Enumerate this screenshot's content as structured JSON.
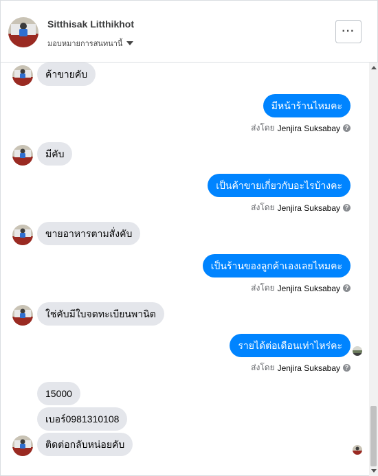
{
  "header": {
    "contact_name": "Sitthisak Litthikhot",
    "assign_label": "มอบหมายการสนทนานี้",
    "more_label": "···"
  },
  "messages": [
    {
      "side": "in",
      "text": "ค้าขายคับ"
    },
    {
      "side": "out",
      "text": "มีหน้าร้านไหมคะ",
      "sent_by_prefix": "ส่งโดย",
      "sent_by_name": "Jenjira Suksabay"
    },
    {
      "side": "in",
      "text": "มีคับ"
    },
    {
      "side": "out",
      "text": "เป็นค้าขายเกี่ยวกับอะไรบ้างคะ",
      "sent_by_prefix": "ส่งโดย",
      "sent_by_name": "Jenjira Suksabay"
    },
    {
      "side": "in",
      "text": "ขายอาหารตามสั่งคับ"
    },
    {
      "side": "out",
      "text": "เป็นร้านของลูกค้าเองเลยไหมคะ",
      "sent_by_prefix": "ส่งโดย",
      "sent_by_name": "Jenjira Suksabay"
    },
    {
      "side": "in",
      "text": "ใช่คับมีใบจดทะเบียนพานิต"
    },
    {
      "side": "out",
      "text": "รายได้ต่อเดือนเท่าไหร่คะ",
      "sent_by_prefix": "ส่งโดย",
      "sent_by_name": "Jenjira Suksabay"
    },
    {
      "side": "in",
      "text": "15000"
    },
    {
      "side": "in",
      "text": "เบอร์0981310108"
    },
    {
      "side": "in",
      "text": "ติดต่อกลับหน่อยคับ"
    }
  ],
  "help_icon_glyph": "?",
  "colors": {
    "outgoing_bubble": "#0084ff",
    "incoming_bubble": "#e4e6eb",
    "secondary_text": "#65676b"
  }
}
